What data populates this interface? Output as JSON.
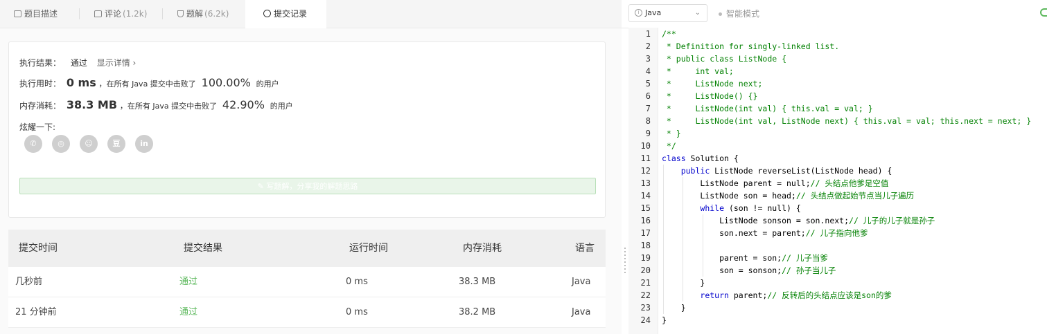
{
  "tabs": [
    {
      "label": "题目描述",
      "count": "",
      "icon": "description-icon"
    },
    {
      "label": "评论",
      "count": "(1.2k)",
      "icon": "comment-icon"
    },
    {
      "label": "题解",
      "count": "(6.2k)",
      "icon": "flask-icon"
    },
    {
      "label": "提交记录",
      "count": "",
      "icon": "clock-icon",
      "active": true
    }
  ],
  "result": {
    "status_label": "执行结果：",
    "status_value": "通过",
    "detail_link": "显示详情 ›",
    "time_label": "执行用时：",
    "time_value": "0 ms",
    "time_mid": "，在所有 Java 提交中击败了",
    "time_pct": "100.00%",
    "time_tail": "的用户",
    "mem_label": "内存消耗：",
    "mem_value": "38.3 MB",
    "mem_mid": "，在所有 Java 提交中击败了",
    "mem_pct": "42.90%",
    "mem_tail": "的用户",
    "share_label": "炫耀一下:",
    "share_icons": [
      "wechat-icon",
      "weibo-icon",
      "qq-icon",
      "douban-icon",
      "linkedin-icon"
    ],
    "share_glyphs": [
      "✆",
      "◎",
      "☺",
      "豆",
      "in"
    ],
    "share_button": "✎ 写题解，分享我的解题思路"
  },
  "table": {
    "headers": [
      "提交时间",
      "提交结果",
      "运行时间",
      "内存消耗",
      "语言"
    ],
    "rows": [
      {
        "time": "几秒前",
        "result": "通过",
        "runtime": "0 ms",
        "memory": "38.3 MB",
        "lang": "Java"
      },
      {
        "time": "21 分钟前",
        "result": "通过",
        "runtime": "0 ms",
        "memory": "38.2 MB",
        "lang": "Java"
      }
    ]
  },
  "editor": {
    "language": "Java",
    "smart_mode": "智能模式",
    "colors": {
      "comment": "#008000",
      "keyword": "#0000cc",
      "pass": "#5cb85c"
    },
    "lines": [
      [
        {
          "t": "/**",
          "c": "comment"
        }
      ],
      [
        {
          "t": " * Definition for singly-linked list.",
          "c": "comment"
        }
      ],
      [
        {
          "t": " * public class ListNode {",
          "c": "comment"
        }
      ],
      [
        {
          "t": " *     int val;",
          "c": "comment"
        }
      ],
      [
        {
          "t": " *     ListNode next;",
          "c": "comment"
        }
      ],
      [
        {
          "t": " *     ListNode() {}",
          "c": "comment"
        }
      ],
      [
        {
          "t": " *     ListNode(int val) { this.val = val; }",
          "c": "comment"
        }
      ],
      [
        {
          "t": " *     ListNode(int val, ListNode next) { this.val = val; this.next = next; }",
          "c": "comment"
        }
      ],
      [
        {
          "t": " * }",
          "c": "comment"
        }
      ],
      [
        {
          "t": " */",
          "c": "comment"
        }
      ],
      [
        {
          "t": "class",
          "c": "kw"
        },
        {
          "t": " Solution {",
          "c": ""
        }
      ],
      [
        {
          "t": "    ",
          "c": ""
        },
        {
          "t": "public",
          "c": "kw"
        },
        {
          "t": " ListNode reverseList(ListNode head) {",
          "c": ""
        }
      ],
      [
        {
          "t": "        ListNode parent = null;",
          "c": ""
        },
        {
          "t": "// 头结点他爹是空值",
          "c": "comment"
        }
      ],
      [
        {
          "t": "        ListNode son = head;",
          "c": ""
        },
        {
          "t": "// 头结点做起始节点当儿子遍历",
          "c": "comment"
        }
      ],
      [
        {
          "t": "        ",
          "c": ""
        },
        {
          "t": "while",
          "c": "kw"
        },
        {
          "t": " (son != null) {",
          "c": ""
        }
      ],
      [
        {
          "t": "            ListNode sonson = son.next;",
          "c": ""
        },
        {
          "t": "// 儿子的儿子就是孙子",
          "c": "comment"
        }
      ],
      [
        {
          "t": "            son.next = parent;",
          "c": ""
        },
        {
          "t": "// 儿子指向他爹",
          "c": "comment"
        }
      ],
      [
        {
          "t": "",
          "c": ""
        }
      ],
      [
        {
          "t": "            parent = son;",
          "c": ""
        },
        {
          "t": "// 儿子当爹",
          "c": "comment"
        }
      ],
      [
        {
          "t": "            son = sonson;",
          "c": ""
        },
        {
          "t": "// 孙子当儿子",
          "c": "comment"
        }
      ],
      [
        {
          "t": "        }",
          "c": ""
        }
      ],
      [
        {
          "t": "        ",
          "c": ""
        },
        {
          "t": "return",
          "c": "kw"
        },
        {
          "t": " parent;",
          "c": ""
        },
        {
          "t": "// 反转后的头结点应该是son的爹",
          "c": "comment"
        }
      ],
      [
        {
          "t": "    }",
          "c": ""
        }
      ],
      [
        {
          "t": "}",
          "c": ""
        }
      ]
    ]
  }
}
